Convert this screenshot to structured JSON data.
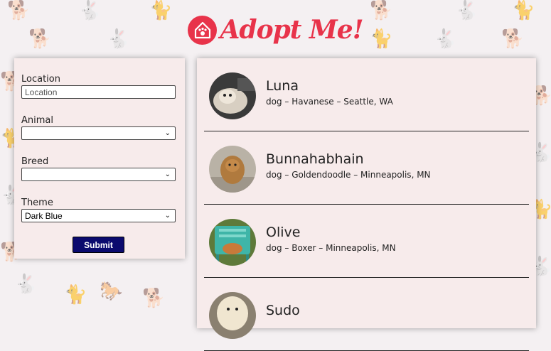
{
  "header": {
    "logo_text": "Adopt Me!"
  },
  "search": {
    "location_label": "Location",
    "location_placeholder": "Location",
    "animal_label": "Animal",
    "animal_value": "",
    "breed_label": "Breed",
    "breed_value": "",
    "theme_label": "Theme",
    "theme_value": "Dark Blue",
    "submit_label": "Submit"
  },
  "pets": [
    {
      "name": "Luna",
      "details": "dog – Havanese – Seattle, WA"
    },
    {
      "name": "Bunnahabhain",
      "details": "dog – Goldendoodle – Minneapolis, MN"
    },
    {
      "name": "Olive",
      "details": "dog – Boxer – Minneapolis, MN"
    },
    {
      "name": "Sudo",
      "details": ""
    }
  ],
  "colors": {
    "brand": "#e8334a",
    "button": "#0b0a6e",
    "panel": "#f7ebeb"
  }
}
